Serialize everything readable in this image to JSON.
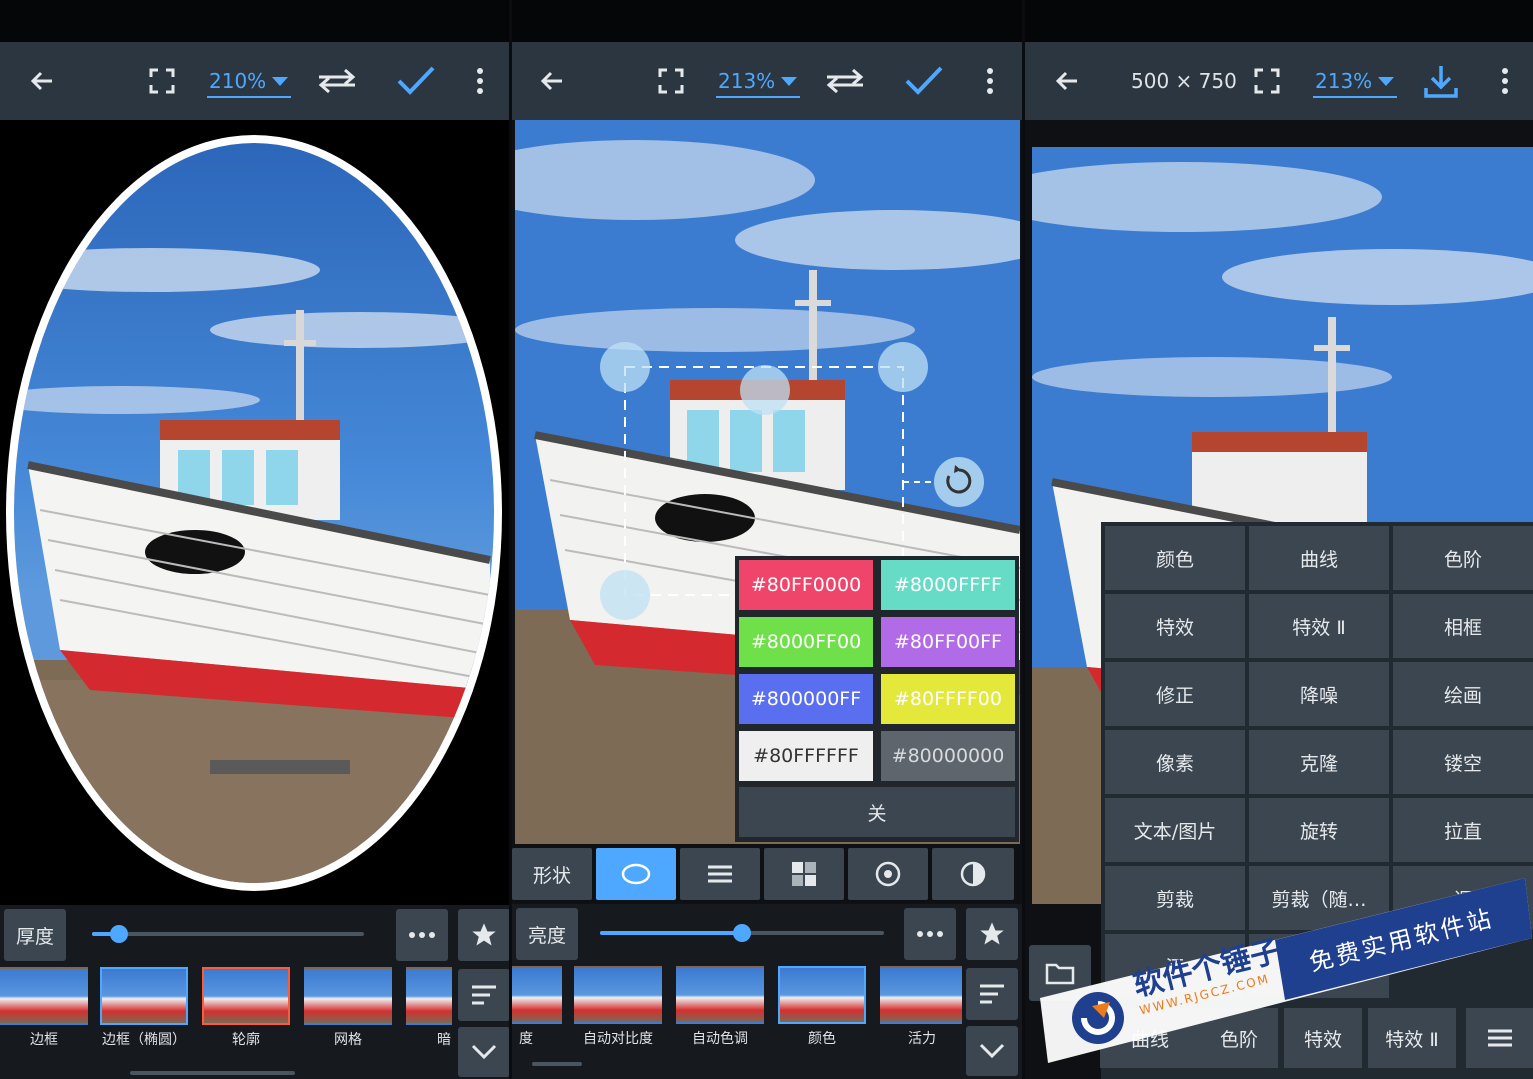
{
  "panel1": {
    "toolbar": {
      "zoom": "210%"
    },
    "bottom": {
      "chip": "厚度",
      "slider_value": 0.1,
      "thumbs": [
        "边框",
        "边框（椭圆）",
        "轮廓",
        "网格",
        "暗"
      ]
    }
  },
  "panel2": {
    "toolbar": {
      "zoom": "213%"
    },
    "colors": [
      {
        "label": "#80FF0000",
        "color": "#f0456a"
      },
      {
        "label": "#8000FFFF",
        "color": "#66dcc7"
      },
      {
        "label": "#8000FF00",
        "color": "#6fe04a"
      },
      {
        "label": "#80FF00FF",
        "color": "#b26be6"
      },
      {
        "label": "#800000FF",
        "color": "#5a6ef0"
      },
      {
        "label": "#80FFFF00",
        "color": "#e3e83a"
      },
      {
        "label": "#80FFFFFF",
        "color": "#efefef"
      },
      {
        "label": "#80000000",
        "color": "#5e656c"
      }
    ],
    "close_label": "关",
    "shape_label": "形状",
    "bottom": {
      "chip": "亮度",
      "slider_value": 0.5,
      "thumbs": [
        "度",
        "自动对比度",
        "自动色调",
        "颜色",
        "活力"
      ]
    }
  },
  "panel3": {
    "toolbar": {
      "dims": "500 × 750",
      "zoom": "213%"
    },
    "menu": [
      "颜色",
      "曲线",
      "色阶",
      "特效",
      "特效 Ⅱ",
      "相框",
      "修正",
      "降噪",
      "绘画",
      "像素",
      "克隆",
      "镂空",
      "文本/图片",
      "旋转",
      "拉直",
      "剪裁",
      "剪裁（随…",
      "调",
      "添"
    ],
    "bottom_tabs": [
      "曲线",
      "色阶",
      "特效",
      "特效 Ⅱ"
    ]
  },
  "watermark": {
    "brand": "软件个锤子",
    "url": "WWW.RJGCZ.COM",
    "slogan": "免费实用软件站"
  },
  "accent_color": "#4ea8ff"
}
